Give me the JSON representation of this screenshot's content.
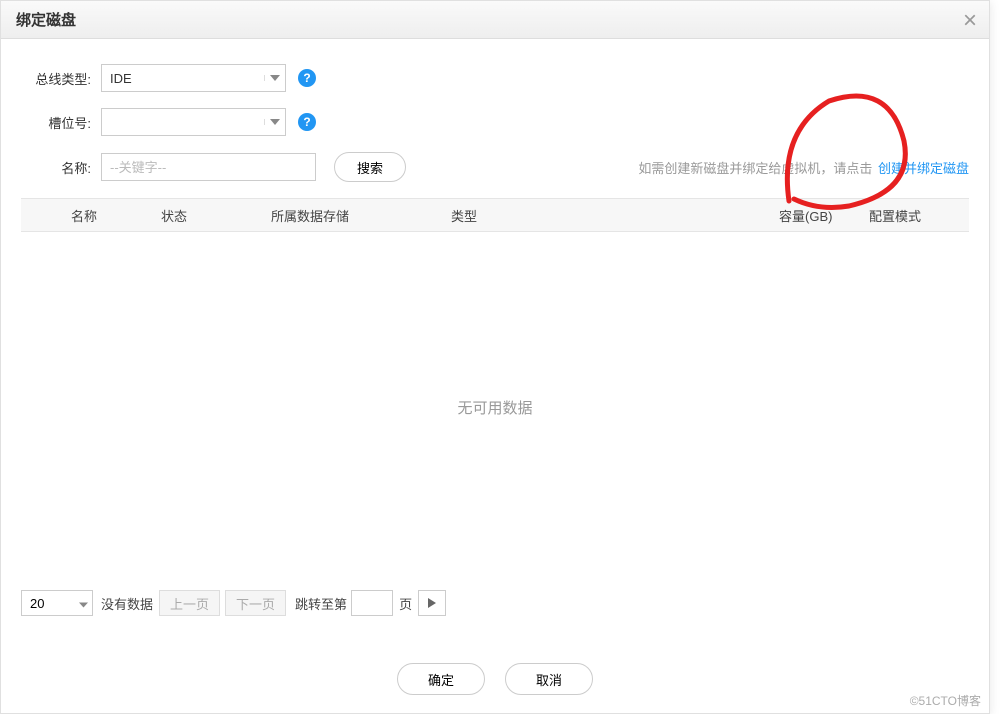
{
  "dialog": {
    "title": "绑定磁盘",
    "close_label": "×"
  },
  "form": {
    "bus_type": {
      "label": "总线类型:",
      "value": "IDE"
    },
    "slot": {
      "label": "槽位号:",
      "value": ""
    },
    "name": {
      "label": "名称:",
      "placeholder": "--关键字--",
      "value": ""
    },
    "search_btn": "搜索"
  },
  "hint": {
    "text": "如需创建新磁盘并绑定给虚拟机，请点击",
    "link": "创建并绑定磁盘"
  },
  "table": {
    "headers": {
      "name": "名称",
      "status": "状态",
      "store": "所属数据存储",
      "type": "类型",
      "capacity": "容量(GB)",
      "mode": "配置模式"
    },
    "empty": "无可用数据"
  },
  "pagination": {
    "page_size": "20",
    "no_data": "没有数据",
    "prev": "上一页",
    "next": "下一页",
    "jump_label": "跳转至第",
    "jump_value": "",
    "page_unit": "页"
  },
  "footer": {
    "ok": "确定",
    "cancel": "取消"
  },
  "watermark": "©51CTO博客"
}
